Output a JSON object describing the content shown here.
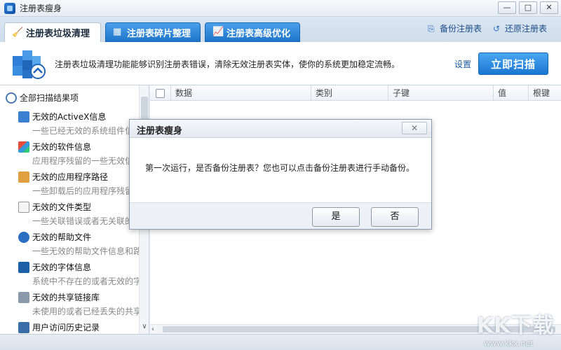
{
  "window": {
    "title": "注册表瘦身",
    "controls": {
      "minimize": "—",
      "maximize": "□",
      "close": "✕"
    }
  },
  "tabs": [
    {
      "label": "注册表垃圾清理",
      "icon": "broom-icon",
      "active": true
    },
    {
      "label": "注册表碎片整理",
      "icon": "defrag-icon",
      "active": false
    },
    {
      "label": "注册表高级优化",
      "icon": "chart-icon",
      "active": false
    }
  ],
  "toplinks": {
    "backup": "备份注册表",
    "restore": "还原注册表"
  },
  "banner": {
    "description": "注册表垃圾清理功能能够识别注册表错误，清除无效注册表实体，使你的系统更加稳定流畅。",
    "settings": "设置",
    "scan_button": "立即扫描"
  },
  "left_panel": {
    "header": "全部扫描结果项",
    "items": [
      {
        "title": "无效的ActiveX信息",
        "desc": "一些已经无效的系统组件信息",
        "icon": "activex-icon"
      },
      {
        "title": "无效的软件信息",
        "desc": "应用程序残留的一些无效信息",
        "icon": "software-icon"
      },
      {
        "title": "无效的应用程序路径",
        "desc": "一些卸载后的应用程序残留路径",
        "icon": "path-icon"
      },
      {
        "title": "无效的文件类型",
        "desc": "一些关联错误或者无关联的文件类型",
        "icon": "filetype-icon"
      },
      {
        "title": "无效的帮助文件",
        "desc": "一些无效的帮助文件信息和路径",
        "icon": "help-icon"
      },
      {
        "title": "无效的字体信息",
        "desc": "系统中不存在的或者无效的字体",
        "icon": "font-icon"
      },
      {
        "title": "无效的共享链接库",
        "desc": "未使用的或者已经丢失的共享库",
        "icon": "dll-icon"
      },
      {
        "title": "用户访问历史记录",
        "desc": "",
        "icon": "history-icon"
      }
    ]
  },
  "grid": {
    "columns": [
      "数据",
      "类别",
      "子键",
      "值",
      "根键"
    ]
  },
  "dialog": {
    "title": "注册表瘦身",
    "close": "✕",
    "message": "第一次运行，是否备份注册表？您也可以点击备份注册表进行手动备份。",
    "yes": "是",
    "no": "否"
  },
  "watermark": {
    "main": "KK下载",
    "url": "www.kkx.net"
  }
}
